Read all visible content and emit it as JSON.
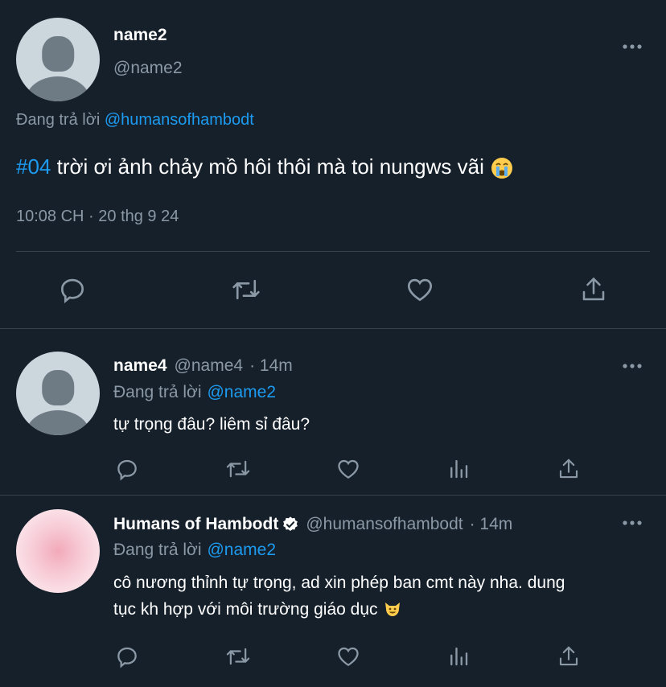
{
  "main_tweet": {
    "name": "name2",
    "handle": "@name2",
    "reply_prefix": "Đang trả lời",
    "reply_target": "@humansofhambodt",
    "hashtag": "#04",
    "text": "trời ơi ảnh chảy mồ hôi thôi mà toi nungws vãi",
    "emoji": "loudly-crying-face",
    "timestamp": "10:08 CH · 20 thg 9 24",
    "actions": [
      "reply-icon",
      "retweet-icon",
      "like-icon",
      "share-icon"
    ]
  },
  "replies": [
    {
      "name": "name4",
      "handle": "@name4",
      "time": "· 14m",
      "reply_prefix": "Đang trả lời",
      "reply_target": "@name2",
      "text": "tự trọng đâu? liêm sỉ đâu?",
      "verified": false
    },
    {
      "name": "Humans of Hambodt",
      "handle": "@humansofhambodt",
      "time": "· 14m",
      "reply_prefix": "Đang trả lời",
      "reply_target": "@name2",
      "text_line1": "cô nương thỉnh tự trọng, ad xin phép ban cmt này nha. dung",
      "text_line2": "tục kh hợp với môi trường giáo dục",
      "emoji": "grinning-cat-face",
      "verified": true
    }
  ],
  "colors": {
    "background": "#15202b",
    "text": "#ffffff",
    "muted": "#8b98a5",
    "accent": "#1d9bf0",
    "divider": "#38444d"
  }
}
